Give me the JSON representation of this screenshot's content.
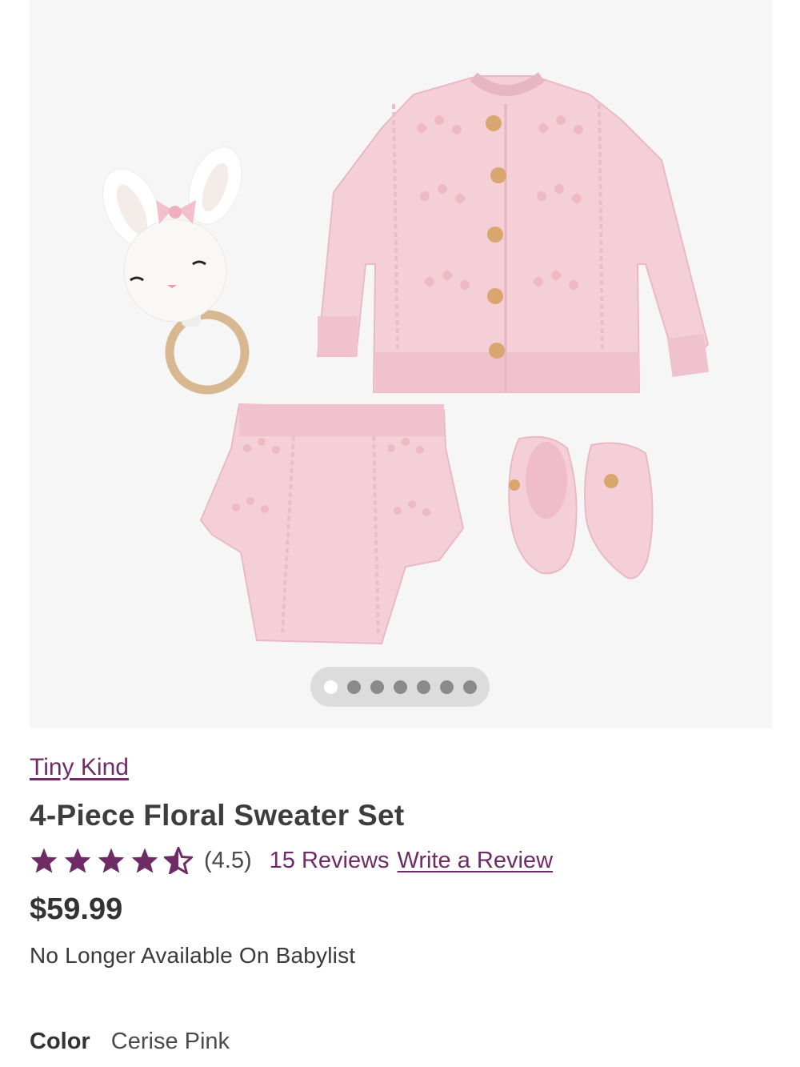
{
  "gallery": {
    "image_alt": "Pink knit sweater set with bunny teether, shorts and booties",
    "dot_count": 7,
    "active_index": 0
  },
  "product": {
    "brand": "Tiny Kind",
    "title": "4-Piece Floral Sweater Set",
    "rating_value": 4.5,
    "rating_text": "(4.5)",
    "reviews_text": "15 Reviews",
    "write_review_text": "Write a Review",
    "price": "$59.99",
    "availability": "No Longer Available On Babylist",
    "color_label": "Color",
    "color_value": "Cerise Pink"
  },
  "colors": {
    "accent": "#6e2b66",
    "gallery_bg": "#f7f6f6",
    "knit_pink": "#f5cfd8"
  },
  "icons": [
    "star-filled-icon",
    "star-half-icon"
  ]
}
